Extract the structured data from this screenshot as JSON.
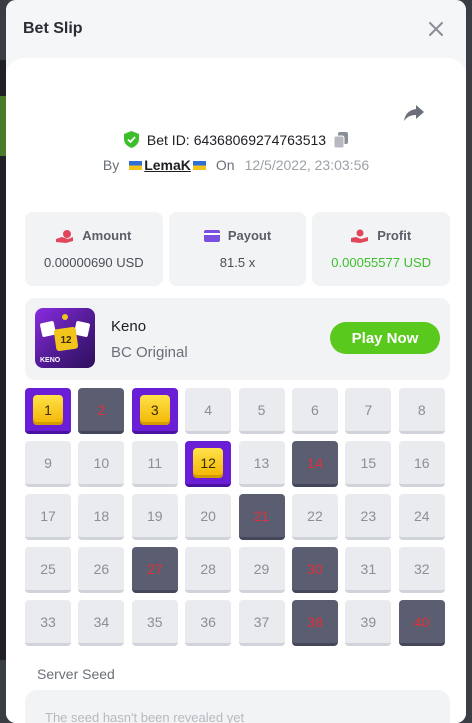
{
  "modal": {
    "title": "Bet Slip"
  },
  "bet": {
    "id_label": "Bet ID:",
    "id": "64368069274763513",
    "by_label": "By",
    "user": "LemaK",
    "on_label": "On",
    "date": "12/5/2022, 23:03:56"
  },
  "stats": [
    {
      "label": "Amount",
      "value": "0.00000690 USD",
      "icon": "coin-hand-icon",
      "color": "#e0475a"
    },
    {
      "label": "Payout",
      "value": "81.5 x",
      "icon": "card-icon",
      "color": "#7b4fe0"
    },
    {
      "label": "Profit",
      "value": "0.00055577 USD",
      "icon": "hand-coins-icon",
      "color": "#e0475a",
      "value_color": "#3cbf2a"
    }
  ],
  "game": {
    "name": "Keno",
    "subtitle": "BC Original",
    "thumb_label": "KENO",
    "thumb_tile": "12",
    "play_label": "Play Now"
  },
  "grid": {
    "cells": [
      {
        "n": "1",
        "state": "hit"
      },
      {
        "n": "2",
        "state": "picked"
      },
      {
        "n": "3",
        "state": "hit"
      },
      {
        "n": "4",
        "state": "none"
      },
      {
        "n": "5",
        "state": "none"
      },
      {
        "n": "6",
        "state": "none"
      },
      {
        "n": "7",
        "state": "none"
      },
      {
        "n": "8",
        "state": "none"
      },
      {
        "n": "9",
        "state": "none"
      },
      {
        "n": "10",
        "state": "none"
      },
      {
        "n": "11",
        "state": "none"
      },
      {
        "n": "12",
        "state": "hit"
      },
      {
        "n": "13",
        "state": "none"
      },
      {
        "n": "14",
        "state": "picked"
      },
      {
        "n": "15",
        "state": "none"
      },
      {
        "n": "16",
        "state": "none"
      },
      {
        "n": "17",
        "state": "none"
      },
      {
        "n": "18",
        "state": "none"
      },
      {
        "n": "19",
        "state": "none"
      },
      {
        "n": "20",
        "state": "none"
      },
      {
        "n": "21",
        "state": "picked"
      },
      {
        "n": "22",
        "state": "none"
      },
      {
        "n": "23",
        "state": "none"
      },
      {
        "n": "24",
        "state": "none"
      },
      {
        "n": "25",
        "state": "none"
      },
      {
        "n": "26",
        "state": "none"
      },
      {
        "n": "27",
        "state": "picked"
      },
      {
        "n": "28",
        "state": "none"
      },
      {
        "n": "29",
        "state": "none"
      },
      {
        "n": "30",
        "state": "picked"
      },
      {
        "n": "31",
        "state": "none"
      },
      {
        "n": "32",
        "state": "none"
      },
      {
        "n": "33",
        "state": "none"
      },
      {
        "n": "34",
        "state": "none"
      },
      {
        "n": "35",
        "state": "none"
      },
      {
        "n": "36",
        "state": "none"
      },
      {
        "n": "37",
        "state": "none"
      },
      {
        "n": "38",
        "state": "picked"
      },
      {
        "n": "39",
        "state": "none"
      },
      {
        "n": "40",
        "state": "picked"
      }
    ]
  },
  "seed": {
    "label": "Server Seed",
    "placeholder": "The seed hasn't been revealed yet"
  }
}
